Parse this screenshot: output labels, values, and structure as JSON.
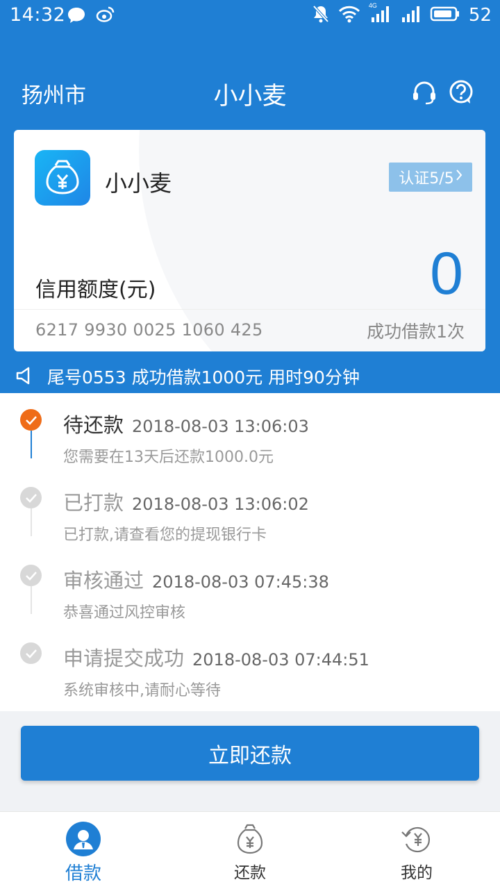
{
  "status_bar": {
    "time": "14:32",
    "network": "4G",
    "battery": "52"
  },
  "header": {
    "city": "扬州市",
    "title": "小小麦"
  },
  "card": {
    "name": "小小麦",
    "cert_badge": "认证5/5",
    "credit_label": "信用额度(元)",
    "credit_amount": "0",
    "card_number": "6217 9930 0025 1060 425",
    "success_count": "成功借款1次"
  },
  "notice": "尾号0553 成功借款1000元 用时90分钟",
  "timeline": [
    {
      "title": "待还款",
      "time": "2018-08-03 13:06:03",
      "desc": "您需要在13天后还款1000.0元",
      "active": true
    },
    {
      "title": "已打款",
      "time": "2018-08-03 13:06:02",
      "desc": "已打款,请查看您的提现银行卡",
      "active": false
    },
    {
      "title": "审核通过",
      "time": "2018-08-03 07:45:38",
      "desc": "恭喜通过风控审核",
      "active": false
    },
    {
      "title": "申请提交成功",
      "time": "2018-08-03 07:44:51",
      "desc": "系统审核中,请耐心等待",
      "active": false
    }
  ],
  "repay_button": "立即还款",
  "tabs": [
    {
      "label": "借款",
      "icon": "user-icon",
      "active": true
    },
    {
      "label": "还款",
      "icon": "money-bag-icon",
      "active": false
    },
    {
      "label": "我的",
      "icon": "refund-icon",
      "active": false
    }
  ],
  "colors": {
    "primary": "#1f7fd4",
    "active_dot": "#ef6c18",
    "inactive_dot": "#d8d8d8"
  }
}
